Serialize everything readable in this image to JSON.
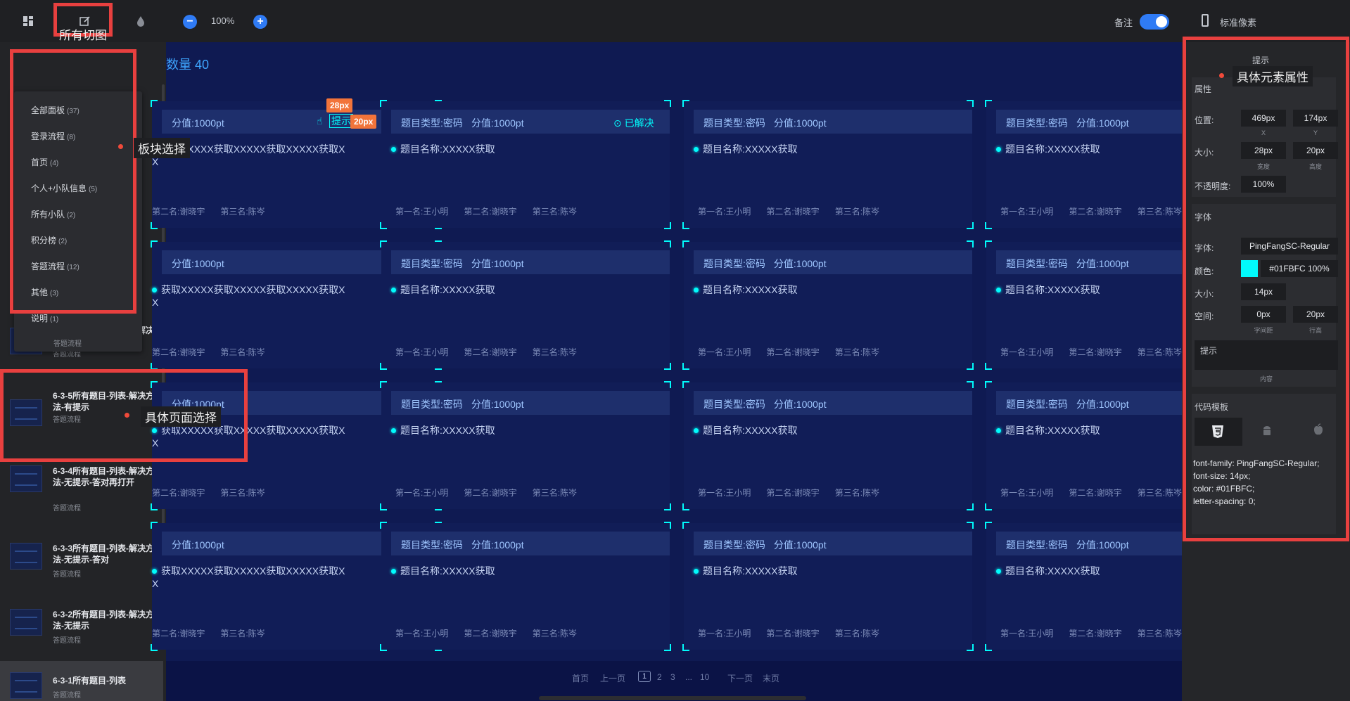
{
  "toolbar": {
    "zoom_value": "100%",
    "note_label": "备注",
    "standard_pixel_label": "标准像素"
  },
  "annotations": {
    "all_slices": "所有切图",
    "block_select": "板块选择",
    "page_select": "具体页面选择",
    "element_props": "具体元素属性"
  },
  "menu": {
    "items": [
      {
        "label": "全部面板",
        "count": "(37)"
      },
      {
        "label": "登录流程",
        "count": "(8)"
      },
      {
        "label": "首页",
        "count": "(4)"
      },
      {
        "label": "个人+小队信息",
        "count": "(5)"
      },
      {
        "label": "所有小队",
        "count": "(2)"
      },
      {
        "label": "积分榜",
        "count": "(2)"
      },
      {
        "label": "答题流程",
        "count": "(12)"
      },
      {
        "label": "其他",
        "count": "(3)"
      },
      {
        "label": "说明",
        "count": "(1)"
      }
    ],
    "hidden_sub": "答题流程"
  },
  "pages": [
    {
      "title": "6-3-6所有题目-列表-已解决队伍",
      "sub": "答题流程"
    },
    {
      "title": "6-3-5所有题目-列表-解决方法-有提示",
      "sub": "答题流程"
    },
    {
      "title": "6-3-4所有题目-列表-解决方法-无提示-答对再打开",
      "sub": "答题流程"
    },
    {
      "title": "6-3-3所有题目-列表-解决方法-无提示-答对",
      "sub": "答题流程"
    },
    {
      "title": "6-3-2所有题目-列表-解决方法-无提示",
      "sub": "答题流程"
    },
    {
      "title": "6-3-1所有题目-列表",
      "sub": "答题流程"
    }
  ],
  "canvas": {
    "count_prefix": "数量",
    "count_value": "40",
    "card": {
      "type_label": "题目类型:密码",
      "score_label": "分值:1000pt",
      "name_label": "题目名称:XXXXX获取",
      "rank1": "第一名:王小明",
      "rank2": "第二名:谢晓宇",
      "rank3": "第三名:陈岑",
      "long_name": "获取XXXXX获取XXXXX获取XXXXX获取X",
      "long_name_wrap": "X",
      "solved_label": "已解决"
    },
    "selected": {
      "text": "提示",
      "width_tag": "28px",
      "height_tag": "20px"
    },
    "pager": {
      "first": "首页",
      "prev": "上一页",
      "current": "1",
      "p2": "2",
      "p3": "3",
      "ellipsis": "...",
      "p10": "10",
      "next": "下一页",
      "last": "末页"
    }
  },
  "inspector": {
    "title": "提示",
    "section_props": "属性",
    "position_label": "位置:",
    "pos_x": "469px",
    "pos_y": "174px",
    "x_label": "X",
    "y_label": "Y",
    "size_label": "大小:",
    "width": "28px",
    "height": "20px",
    "width_label": "宽度",
    "height_label": "高度",
    "opacity_label": "不透明度:",
    "opacity": "100%",
    "section_font": "字体",
    "font_label": "字体:",
    "font_value": "PingFangSC-Regular",
    "color_label": "颜色:",
    "color_value": "#01FBFC 100%",
    "color_swatch": "#01FBFC",
    "fsize_label": "大小:",
    "fsize_value": "14px",
    "space_label": "空间:",
    "letter_spacing": "0px",
    "line_height": "20px",
    "letter_spacing_label": "字间距",
    "line_height_label": "行高",
    "content_value": "提示",
    "content_label": "内容",
    "code_section": "代码模板",
    "code_lines": [
      "font-family: PingFangSC-Regular;",
      "font-size: 14px;",
      "color: #01FBFC;",
      "letter-spacing: 0;"
    ]
  },
  "icons": [
    "grid-icon",
    "slice-icon",
    "drop-icon",
    "zoom-out-icon",
    "zoom-in-icon",
    "phone-icon",
    "css3-icon",
    "android-icon",
    "apple-icon",
    "check-circle-icon",
    "hand-pointer-icon"
  ]
}
